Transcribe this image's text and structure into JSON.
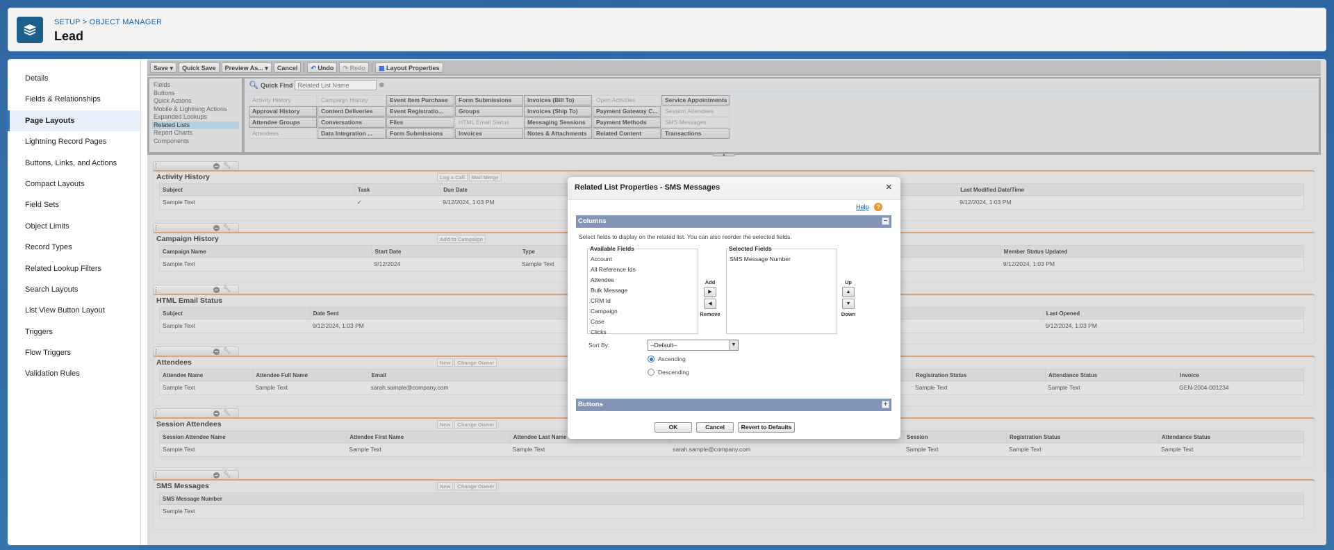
{
  "header": {
    "breadcrumb": "SETUP > OBJECT MANAGER",
    "title": "Lead",
    "icon": "layers-icon"
  },
  "sidebar": {
    "active": "Page Layouts",
    "items": [
      "Details",
      "Fields & Relationships",
      "Page Layouts",
      "Lightning Record Pages",
      "Buttons, Links, and Actions",
      "Compact Layouts",
      "Field Sets",
      "Object Limits",
      "Record Types",
      "Related Lookup Filters",
      "Search Layouts",
      "List View Button Layout",
      "Triggers",
      "Flow Triggers",
      "Validation Rules"
    ]
  },
  "toolbar": {
    "save": "Save",
    "quick_save": "Quick Save",
    "preview_as": "Preview As...",
    "cancel": "Cancel",
    "undo": "Undo",
    "redo": "Redo",
    "layout_properties": "Layout Properties"
  },
  "palette": {
    "categories": [
      "Fields",
      "Buttons",
      "Quick Actions",
      "Mobile & Lightning Actions",
      "Expanded Lookups",
      "Related Lists",
      "Report Charts",
      "Components"
    ],
    "active_category": "Related Lists",
    "quick_find_label": "Quick Find",
    "quick_find_placeholder": "Related List Name",
    "items": [
      {
        "label": "Activity History",
        "used": true
      },
      {
        "label": "Campaign History",
        "used": true
      },
      {
        "label": "Event Item Purchase",
        "used": false
      },
      {
        "label": "Form Submissions",
        "used": false
      },
      {
        "label": "Invoices (Bill To)",
        "used": false
      },
      {
        "label": "Open Activities",
        "used": true
      },
      {
        "label": "Service Appointments",
        "used": false
      },
      {
        "label": "Approval History",
        "used": false
      },
      {
        "label": "Content Deliveries",
        "used": false
      },
      {
        "label": "Event Registratio...",
        "used": false
      },
      {
        "label": "Groups",
        "used": false
      },
      {
        "label": "Invoices (Ship To)",
        "used": false
      },
      {
        "label": "Payment Gateway C...",
        "used": false
      },
      {
        "label": "Session Attendees",
        "used": true
      },
      {
        "label": "Attendee Groups",
        "used": false
      },
      {
        "label": "Conversations",
        "used": false
      },
      {
        "label": "Files",
        "used": false
      },
      {
        "label": "HTML Email Status",
        "used": true
      },
      {
        "label": "Messaging Sessions",
        "used": false
      },
      {
        "label": "Payment Methods",
        "used": false
      },
      {
        "label": "SMS Messages",
        "used": true
      },
      {
        "label": "Attendees",
        "used": true
      },
      {
        "label": "Data Integration ...",
        "used": false
      },
      {
        "label": "Form Submissions",
        "used": false
      },
      {
        "label": "Invoices",
        "used": false
      },
      {
        "label": "Notes & Attachments",
        "used": false
      },
      {
        "label": "Related Content",
        "used": false
      },
      {
        "label": "Transactions",
        "used": false
      }
    ]
  },
  "sections": [
    {
      "title": "Activity History",
      "buttons": [
        "Log a Call",
        "Mail Merge"
      ],
      "columns": [
        "Subject",
        "Task",
        "Due Date",
        "Last Modified Date/Time"
      ],
      "row": [
        "Sample Text",
        "✓",
        "9/12/2024, 1:03 PM",
        "9/12/2024, 1:03 PM"
      ]
    },
    {
      "title": "Campaign History",
      "buttons": [
        "Add to Campaign"
      ],
      "columns": [
        "Campaign Name",
        "Start Date",
        "Type",
        "Member Status Updated"
      ],
      "row": [
        "Sample Text",
        "9/12/2024",
        "Sample Text",
        "9/12/2024, 1:03 PM"
      ]
    },
    {
      "title": "HTML Email Status",
      "buttons": [],
      "columns": [
        "Subject",
        "Date Sent",
        "Last Opened"
      ],
      "row": [
        "Sample Text",
        "9/12/2024, 1:03 PM",
        "9/12/2024, 1:03 PM"
      ]
    },
    {
      "title": "Attendees",
      "buttons": [
        "New",
        "Change Owner"
      ],
      "columns": [
        "Attendee Name",
        "Attendee Full Name",
        "Email",
        "Registration Status",
        "Attendance Status",
        "Invoice"
      ],
      "row": [
        "Sample Text",
        "Sample Text",
        "sarah.sample@company.com",
        "Sample Text",
        "Sample Text",
        "GEN-2004-001234"
      ]
    },
    {
      "title": "Session Attendees",
      "buttons": [
        "New",
        "Change Owner"
      ],
      "columns": [
        "Session Attendee Name",
        "Attendee First Name",
        "Attendee Last Name",
        "Attendee Email",
        "Session",
        "Registration Status",
        "Attendance Status"
      ],
      "row": [
        "Sample Text",
        "Sample Text",
        "Sample Text",
        "sarah.sample@company.com",
        "Sample Text",
        "Sample Text",
        "Sample Text"
      ]
    },
    {
      "title": "SMS Messages",
      "buttons": [
        "New",
        "Change Owner"
      ],
      "columns": [
        "SMS Message Number"
      ],
      "row": [
        "Sample Text"
      ]
    }
  ],
  "modal": {
    "title": "Related List Properties - SMS Messages",
    "help": "Help",
    "columns_label": "Columns",
    "description": "Select fields to display on the related list. You can also reorder the selected fields.",
    "available_label": "Available Fields",
    "available": [
      "Account",
      "All Reference Ids",
      "Attendee",
      "Bulk Message",
      "CRM Id",
      "Campaign",
      "Case",
      "Clicks"
    ],
    "selected_label": "Selected Fields",
    "selected": [
      "SMS Message Number"
    ],
    "add": "Add",
    "remove": "Remove",
    "up": "Up",
    "down": "Down",
    "sort_by_label": "Sort By:",
    "sort_by_value": "--Default--",
    "ascending": "Ascending",
    "descending": "Descending",
    "sort_order": "Ascending",
    "buttons_label": "Buttons",
    "ok": "OK",
    "cancel": "Cancel",
    "revert": "Revert to Defaults"
  },
  "colors": {
    "accent": "#1f7ce0",
    "section_border": "#dca276",
    "modal_bar": "#8295b8",
    "help_icon": "#e8942a"
  }
}
